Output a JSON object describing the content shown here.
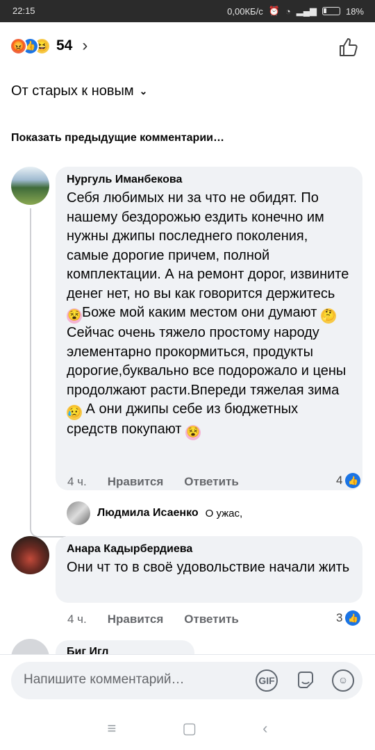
{
  "status": {
    "time": "22:15",
    "speed": "0,00КБ/с",
    "battery": "18%"
  },
  "reactions": {
    "count": "54",
    "icons": [
      "angry-icon",
      "like-icon",
      "haha-icon"
    ]
  },
  "sort": {
    "label": "От старых к новым"
  },
  "previous_comments": "Показать предыдущие комментарии…",
  "comments": [
    {
      "author": "Нургуль Иманбекова",
      "text_parts": [
        "Себя любимых ни за что не обидят. По нашему бездорожью ездить конечно им нужны джипы последнего поколения, самые дорогие причем, полной комплектации. А на ремонт дорог, извините денег нет, но вы как говорится держитесь ",
        "Боже мой каким местом они думают ",
        "Сейчас очень тяжело простому народу элементарно прокормиться, продукты дорогие,буквально все подорожало и цены продолжают расти.Впереди тяжелая зима ",
        " А они джипы себе из бюджетных средств покупают "
      ],
      "time": "4 ч.",
      "like_label": "Нравится",
      "reply_label": "Ответить",
      "likes": "4",
      "reply_preview": {
        "author": "Людмила Исаенко",
        "snippet": "О ужас,"
      }
    },
    {
      "author": "Анара Кадырбердиева",
      "text": "Они чт то в своё удовольствие начали жить",
      "time": "4 ч.",
      "like_label": "Нравится",
      "reply_label": "Ответить",
      "likes": "3"
    },
    {
      "author_partial": "Биг Игл"
    }
  ],
  "composer": {
    "placeholder": "Напишите комментарий…",
    "gif_label": "GIF"
  },
  "colors": {
    "accent": "#1b74e4",
    "bubble": "#f0f2f5",
    "muted": "#65676b"
  }
}
